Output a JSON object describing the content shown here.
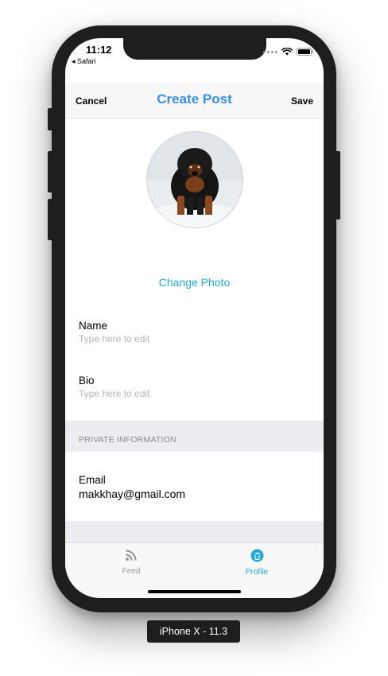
{
  "status_bar": {
    "time": "11:12",
    "back_app": "◂ Safari",
    "icons": [
      "signal-icon",
      "wifi-icon",
      "battery-icon"
    ]
  },
  "navbar": {
    "cancel_label": "Cancel",
    "title": "Create Post",
    "save_label": "Save",
    "title_color": "#3a8ee6"
  },
  "profile": {
    "photo_icon": "dog-photo",
    "change_photo_label": "Change Photo",
    "link_color": "#22a7dc"
  },
  "fields": {
    "name": {
      "label": "Name",
      "placeholder": "Type here to edit"
    },
    "bio": {
      "label": "Bio",
      "placeholder": "Type here to edit"
    }
  },
  "private_section": {
    "header": "PRIVATE INFORMATION",
    "email": {
      "label": "Email",
      "value": "makkhay@gmail.com"
    }
  },
  "tabbar": {
    "items": [
      {
        "label": "Feed",
        "icon": "rss-feed-icon",
        "selected": false
      },
      {
        "label": "Profile",
        "icon": "profile-icon",
        "selected": true
      }
    ],
    "active_color": "#22a7dc",
    "inactive_color": "#9a9a9a"
  },
  "device_label": "iPhone X - 11.3"
}
